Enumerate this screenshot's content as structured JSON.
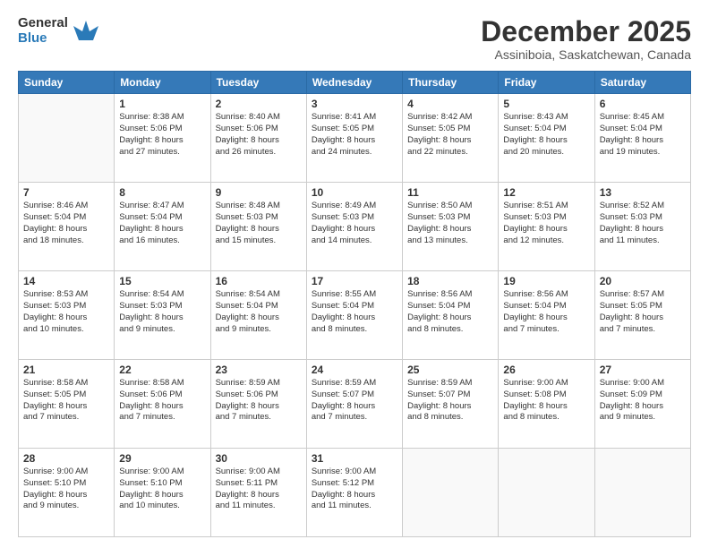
{
  "header": {
    "logo": {
      "general": "General",
      "blue": "Blue"
    },
    "title": "December 2025",
    "location": "Assiniboia, Saskatchewan, Canada"
  },
  "calendar": {
    "days_of_week": [
      "Sunday",
      "Monday",
      "Tuesday",
      "Wednesday",
      "Thursday",
      "Friday",
      "Saturday"
    ],
    "weeks": [
      [
        {
          "day": "",
          "info": ""
        },
        {
          "day": "1",
          "info": "Sunrise: 8:38 AM\nSunset: 5:06 PM\nDaylight: 8 hours\nand 27 minutes."
        },
        {
          "day": "2",
          "info": "Sunrise: 8:40 AM\nSunset: 5:06 PM\nDaylight: 8 hours\nand 26 minutes."
        },
        {
          "day": "3",
          "info": "Sunrise: 8:41 AM\nSunset: 5:05 PM\nDaylight: 8 hours\nand 24 minutes."
        },
        {
          "day": "4",
          "info": "Sunrise: 8:42 AM\nSunset: 5:05 PM\nDaylight: 8 hours\nand 22 minutes."
        },
        {
          "day": "5",
          "info": "Sunrise: 8:43 AM\nSunset: 5:04 PM\nDaylight: 8 hours\nand 20 minutes."
        },
        {
          "day": "6",
          "info": "Sunrise: 8:45 AM\nSunset: 5:04 PM\nDaylight: 8 hours\nand 19 minutes."
        }
      ],
      [
        {
          "day": "7",
          "info": "Sunrise: 8:46 AM\nSunset: 5:04 PM\nDaylight: 8 hours\nand 18 minutes."
        },
        {
          "day": "8",
          "info": "Sunrise: 8:47 AM\nSunset: 5:04 PM\nDaylight: 8 hours\nand 16 minutes."
        },
        {
          "day": "9",
          "info": "Sunrise: 8:48 AM\nSunset: 5:03 PM\nDaylight: 8 hours\nand 15 minutes."
        },
        {
          "day": "10",
          "info": "Sunrise: 8:49 AM\nSunset: 5:03 PM\nDaylight: 8 hours\nand 14 minutes."
        },
        {
          "day": "11",
          "info": "Sunrise: 8:50 AM\nSunset: 5:03 PM\nDaylight: 8 hours\nand 13 minutes."
        },
        {
          "day": "12",
          "info": "Sunrise: 8:51 AM\nSunset: 5:03 PM\nDaylight: 8 hours\nand 12 minutes."
        },
        {
          "day": "13",
          "info": "Sunrise: 8:52 AM\nSunset: 5:03 PM\nDaylight: 8 hours\nand 11 minutes."
        }
      ],
      [
        {
          "day": "14",
          "info": "Sunrise: 8:53 AM\nSunset: 5:03 PM\nDaylight: 8 hours\nand 10 minutes."
        },
        {
          "day": "15",
          "info": "Sunrise: 8:54 AM\nSunset: 5:03 PM\nDaylight: 8 hours\nand 9 minutes."
        },
        {
          "day": "16",
          "info": "Sunrise: 8:54 AM\nSunset: 5:04 PM\nDaylight: 8 hours\nand 9 minutes."
        },
        {
          "day": "17",
          "info": "Sunrise: 8:55 AM\nSunset: 5:04 PM\nDaylight: 8 hours\nand 8 minutes."
        },
        {
          "day": "18",
          "info": "Sunrise: 8:56 AM\nSunset: 5:04 PM\nDaylight: 8 hours\nand 8 minutes."
        },
        {
          "day": "19",
          "info": "Sunrise: 8:56 AM\nSunset: 5:04 PM\nDaylight: 8 hours\nand 7 minutes."
        },
        {
          "day": "20",
          "info": "Sunrise: 8:57 AM\nSunset: 5:05 PM\nDaylight: 8 hours\nand 7 minutes."
        }
      ],
      [
        {
          "day": "21",
          "info": "Sunrise: 8:58 AM\nSunset: 5:05 PM\nDaylight: 8 hours\nand 7 minutes."
        },
        {
          "day": "22",
          "info": "Sunrise: 8:58 AM\nSunset: 5:06 PM\nDaylight: 8 hours\nand 7 minutes."
        },
        {
          "day": "23",
          "info": "Sunrise: 8:59 AM\nSunset: 5:06 PM\nDaylight: 8 hours\nand 7 minutes."
        },
        {
          "day": "24",
          "info": "Sunrise: 8:59 AM\nSunset: 5:07 PM\nDaylight: 8 hours\nand 7 minutes."
        },
        {
          "day": "25",
          "info": "Sunrise: 8:59 AM\nSunset: 5:07 PM\nDaylight: 8 hours\nand 8 minutes."
        },
        {
          "day": "26",
          "info": "Sunrise: 9:00 AM\nSunset: 5:08 PM\nDaylight: 8 hours\nand 8 minutes."
        },
        {
          "day": "27",
          "info": "Sunrise: 9:00 AM\nSunset: 5:09 PM\nDaylight: 8 hours\nand 9 minutes."
        }
      ],
      [
        {
          "day": "28",
          "info": "Sunrise: 9:00 AM\nSunset: 5:10 PM\nDaylight: 8 hours\nand 9 minutes."
        },
        {
          "day": "29",
          "info": "Sunrise: 9:00 AM\nSunset: 5:10 PM\nDaylight: 8 hours\nand 10 minutes."
        },
        {
          "day": "30",
          "info": "Sunrise: 9:00 AM\nSunset: 5:11 PM\nDaylight: 8 hours\nand 11 minutes."
        },
        {
          "day": "31",
          "info": "Sunrise: 9:00 AM\nSunset: 5:12 PM\nDaylight: 8 hours\nand 11 minutes."
        },
        {
          "day": "",
          "info": ""
        },
        {
          "day": "",
          "info": ""
        },
        {
          "day": "",
          "info": ""
        }
      ]
    ]
  }
}
